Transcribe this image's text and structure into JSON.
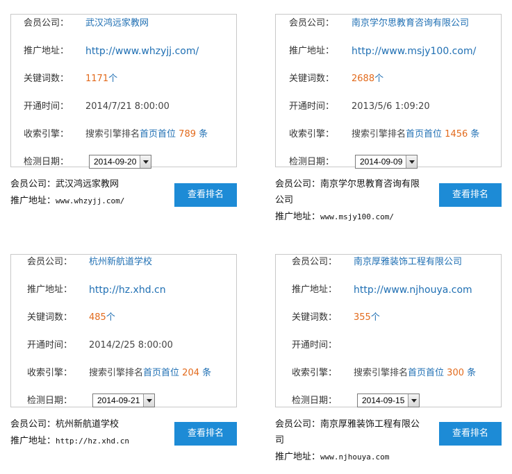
{
  "cards": [
    {
      "company_label": "会员公司：",
      "company": "武汉鸿远家教网",
      "url_label": "推广地址：",
      "url": "http://www.whzyjj.com/",
      "keywords_label": "关键词数：",
      "keywords": "1171",
      "keywords_unit": "个",
      "open_label": "开通时间：",
      "open_time": "2014/7/21 8:00:00",
      "engine_label": "收索引擎：",
      "engine_text": "搜索引擎排名",
      "engine_link": "首页首位",
      "engine_count": "789",
      "engine_unit": "条",
      "check_label": "检测日期：",
      "check_date": "2014-09-20",
      "footer_company_label": "会员公司：",
      "footer_company": "武汉鸿远家教网",
      "footer_url_label": "推广地址：",
      "footer_url": "www.whzyjj.com/",
      "button": "查看排名"
    },
    {
      "company_label": "会员公司：",
      "company": "南京学尔思教育咨询有限公司",
      "url_label": "推广地址：",
      "url": "http://www.msjy100.com/",
      "keywords_label": "关键词数：",
      "keywords": "2688",
      "keywords_unit": "个",
      "open_label": "开通时间：",
      "open_time": "2013/5/6 1:09:20",
      "engine_label": "收索引擎：",
      "engine_text": "搜索引擎排名",
      "engine_link": "首页首位",
      "engine_count": "1456",
      "engine_unit": "条",
      "check_label": "检测日期：",
      "check_date": "2014-09-09",
      "footer_company_label": "会员公司：",
      "footer_company_1": "南京学尔思教育咨询有限",
      "footer_company_2": "公司",
      "footer_url_label": "推广地址：",
      "footer_url": "www.msjy100.com/",
      "button": "查看排名"
    },
    {
      "company_label": "会员公司：",
      "company": "杭州新航道学校",
      "url_label": "推广地址：",
      "url": "http://hz.xhd.cn",
      "keywords_label": "关键词数：",
      "keywords": "485",
      "keywords_unit": "个",
      "open_label": "开通时间：",
      "open_time": "2014/2/25 8:00:00",
      "engine_label": "收索引擎：",
      "engine_text": "搜索引擎排名",
      "engine_link": "首页首位",
      "engine_count": "204",
      "engine_unit": "条",
      "check_label": "检测日期：",
      "check_date": "2014-09-21",
      "footer_company_label": "会员公司：",
      "footer_company": "杭州新航道学校",
      "footer_url_label": "推广地址：",
      "footer_url": "http://hz.xhd.cn",
      "button": "查看排名"
    },
    {
      "company_label": "会员公司：",
      "company": "南京厚雅装饰工程有限公司",
      "url_label": "推广地址：",
      "url": "http://www.njhouya.com",
      "keywords_label": "关键词数：",
      "keywords": "355",
      "keywords_unit": "个",
      "open_label": "开通时间：",
      "open_time": "",
      "engine_label": "收索引擎：",
      "engine_text": "搜索引擎排名",
      "engine_link": "首页首位",
      "engine_count": "300",
      "engine_unit": "条",
      "check_label": "检测日期：",
      "check_date": "2014-09-15",
      "footer_company_label": "会员公司：",
      "footer_company_1": "南京厚雅装饰工程有限公",
      "footer_company_2": "司",
      "footer_url_label": "推广地址：",
      "footer_url": "www.njhouya.com",
      "button": "查看排名"
    }
  ]
}
